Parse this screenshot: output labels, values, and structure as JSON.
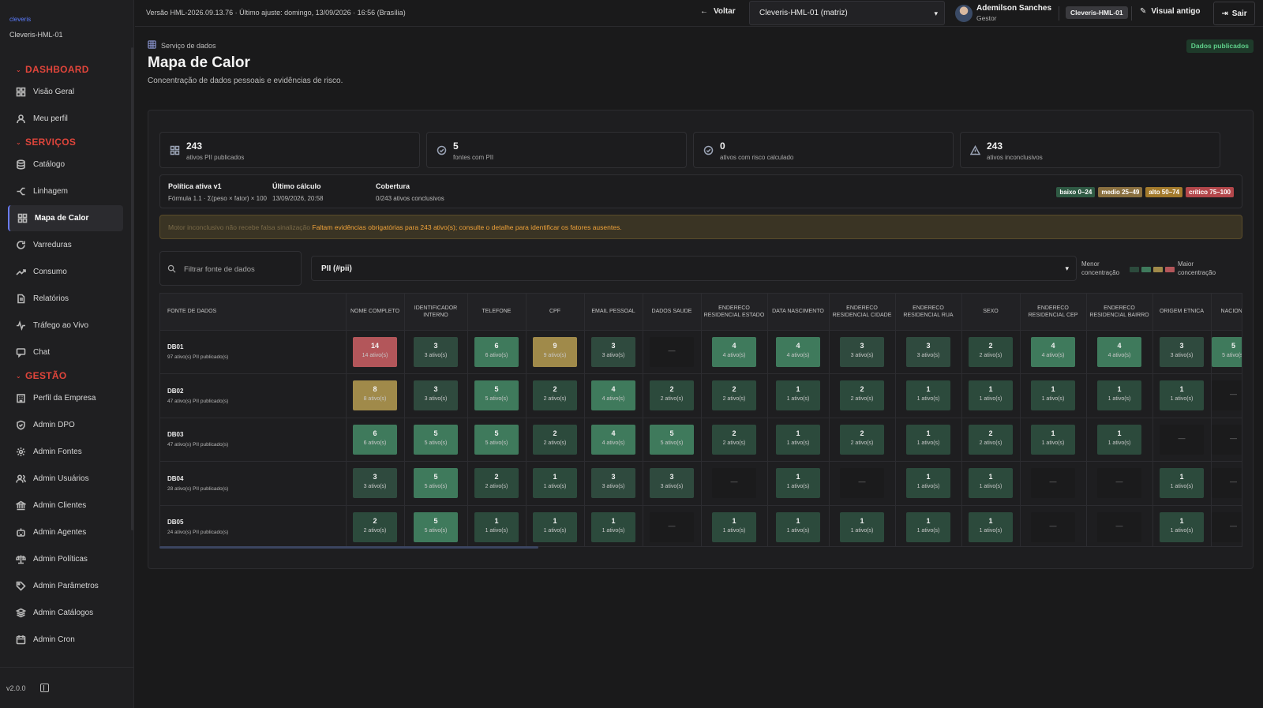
{
  "app": {
    "logo": "cleveris",
    "tenant_label": "Cleveris-HML-01",
    "version": "v2.0.0"
  },
  "topbar": {
    "version_text": "Versão HML-2026.09.13.76 · Último ajuste: domingo, 13/09/2026 · 16:56 (Brasília)",
    "back_label": "Voltar",
    "tenant_select": "Cleveris-HML-01 (matriz)",
    "user_name": "Ademilson Sanches",
    "user_role": "Gestor",
    "tenant_badge": "Cleveris-HML-01",
    "old_visual_label": "Visual antigo",
    "logout_label": "Sair"
  },
  "sidebar": {
    "sections": [
      {
        "title": "DASHBOARD",
        "items": [
          {
            "label": "Visão Geral",
            "icon": "grid-icon"
          },
          {
            "label": "Meu perfil",
            "icon": "user-icon"
          }
        ]
      },
      {
        "title": "SERVIÇOS",
        "items": [
          {
            "label": "Catálogo",
            "icon": "database-icon"
          },
          {
            "label": "Linhagem",
            "icon": "lineage-icon"
          },
          {
            "label": "Mapa de Calor",
            "icon": "grid-icon",
            "active": true
          },
          {
            "label": "Varreduras",
            "icon": "refresh-icon"
          },
          {
            "label": "Consumo",
            "icon": "trend-icon"
          },
          {
            "label": "Relatórios",
            "icon": "document-icon"
          },
          {
            "label": "Tráfego ao Vivo",
            "icon": "pulse-icon"
          },
          {
            "label": "Chat",
            "icon": "chat-icon"
          }
        ]
      },
      {
        "title": "GESTÃO",
        "items": [
          {
            "label": "Perfil da Empresa",
            "icon": "building-icon"
          },
          {
            "label": "Admin DPO",
            "icon": "shield-icon"
          },
          {
            "label": "Admin Fontes",
            "icon": "gear-icon"
          },
          {
            "label": "Admin Usuários",
            "icon": "users-icon"
          },
          {
            "label": "Admin Clientes",
            "icon": "bank-icon"
          },
          {
            "label": "Admin Agentes",
            "icon": "bot-icon"
          },
          {
            "label": "Admin Políticas",
            "icon": "scale-icon"
          },
          {
            "label": "Admin Parâmetros",
            "icon": "tag-icon"
          },
          {
            "label": "Admin Catálogos",
            "icon": "layers-icon"
          },
          {
            "label": "Admin Cron",
            "icon": "calendar-icon"
          }
        ]
      }
    ]
  },
  "main": {
    "breadcrumb": "Serviço de dados",
    "title": "Mapa de Calor",
    "subtitle": "Concentração de dados pessoais e evidências de risco.",
    "published_badge": "Dados publicados",
    "stats": [
      {
        "value": "243",
        "label": "ativos PII publicados",
        "icon": "grid-icon"
      },
      {
        "value": "5",
        "label": "fontes com PII",
        "icon": "check-circle-icon"
      },
      {
        "value": "0",
        "label": "ativos com risco calculado",
        "icon": "check-circle-icon"
      },
      {
        "value": "243",
        "label": "ativos inconclusivos",
        "icon": "warning-icon"
      }
    ],
    "policy": {
      "active_title": "Política ativa v1",
      "active_formula": "Fórmula 1.1 · Σ(peso × fator) × 100",
      "last_calc_title": "Último cálculo",
      "last_calc_value": "13/09/2026, 20:58",
      "coverage_title": "Cobertura",
      "coverage_value": "0/243 ativos conclusivos",
      "badges": [
        {
          "label": "baixo 0–24",
          "color": "#2f5a44"
        },
        {
          "label": "medio 25–49",
          "color": "#8a7040"
        },
        {
          "label": "alto 50–74",
          "color": "#a37a2c"
        },
        {
          "label": "crítico 75–100",
          "color": "#b3474b"
        }
      ]
    },
    "warning": {
      "faded": "Motor inconclusivo não recebe falsa sinalização",
      "strong": "Faltam evidências obrigatórias para 243 ativo(s); consulte o detalhe para identificar os fatores ausentes."
    },
    "filter_placeholder": "Filtrar fonte de dados",
    "pii_select": "PII (#pii)",
    "concentration": {
      "low": "Menor concentração",
      "high": "Maior concentração",
      "colors": [
        "#2c4a3c",
        "#3f7a5c",
        "#a08a4a",
        "#b3565a"
      ]
    }
  },
  "table": {
    "columns": [
      "FONTE DE DADOS",
      "NOME COMPLETO",
      "IDENTIFICADOR INTERNO",
      "TELEFONE",
      "CPF",
      "EMAIL PESSOAL",
      "DADOS SAUDE",
      "ENDERECO RESIDENCIAL ESTADO",
      "DATA NASCIMENTO",
      "ENDERECO RESIDENCIAL CIDADE",
      "ENDERECO RESIDENCIAL RUA",
      "SEXO",
      "ENDERECO RESIDENCIAL CEP",
      "ENDERECO RESIDENCIAL BAIRRO",
      "ORIGEM ETNICA",
      "NACIONA"
    ],
    "rows": [
      {
        "name": "DB01",
        "sub": "97 ativo(s) PII publicado(s)",
        "cells": [
          14,
          3,
          6,
          9,
          3,
          null,
          4,
          4,
          3,
          3,
          2,
          4,
          4,
          3,
          5
        ]
      },
      {
        "name": "DB02",
        "sub": "47 ativo(s) PII publicado(s)",
        "cells": [
          8,
          3,
          5,
          2,
          4,
          2,
          2,
          1,
          2,
          1,
          1,
          1,
          1,
          1,
          null
        ]
      },
      {
        "name": "DB03",
        "sub": "47 ativo(s) PII publicado(s)",
        "cells": [
          6,
          5,
          5,
          2,
          4,
          5,
          2,
          1,
          2,
          1,
          2,
          1,
          1,
          null,
          null
        ]
      },
      {
        "name": "DB04",
        "sub": "28 ativo(s) PII publicado(s)",
        "cells": [
          3,
          5,
          2,
          1,
          3,
          3,
          null,
          1,
          null,
          1,
          1,
          null,
          null,
          1,
          null
        ]
      },
      {
        "name": "DB05",
        "sub": "24 ativo(s) PII publicado(s)",
        "cells": [
          2,
          5,
          1,
          1,
          1,
          null,
          1,
          1,
          1,
          1,
          1,
          null,
          null,
          1,
          null
        ]
      }
    ],
    "cell_suffix": "ativo(s)",
    "empty_mark": "—"
  }
}
